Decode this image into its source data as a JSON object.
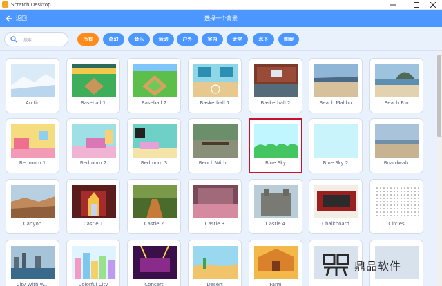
{
  "window": {
    "title": "Scratch Desktop"
  },
  "header": {
    "back_label": "返回",
    "title": "选择一个背景"
  },
  "search": {
    "placeholder": "搜索"
  },
  "tags": [
    "所有",
    "奇幻",
    "音乐",
    "运动",
    "户外",
    "室内",
    "太空",
    "水下",
    "图案"
  ],
  "active_tag": "所有",
  "backdrops": [
    "Arctic",
    "Baseball 1",
    "Baseball 2",
    "Basketball 1",
    "Basketball 2",
    "Beach Malibu",
    "Beach Rio",
    "Bedroom 1",
    "Bedroom 2",
    "Bedroom 3",
    "Bench With...",
    "Blue Sky",
    "Blue Sky 2",
    "Boardwalk",
    "Canyon",
    "Castle 1",
    "Castle 2",
    "Castle 3",
    "Castle 4",
    "Chalkboard",
    "Circles",
    "City With W...",
    "Colorful City",
    "Concert",
    "Desert",
    "Farm",
    "",
    ""
  ],
  "selected_backdrop": "Blue Sky",
  "watermark": {
    "text": "鼎品软件"
  },
  "colors": {
    "header": "#4c97ff",
    "active_tag": "#ff8c1a",
    "selected_border": "#c8102e",
    "background": "#e9f1fc"
  }
}
